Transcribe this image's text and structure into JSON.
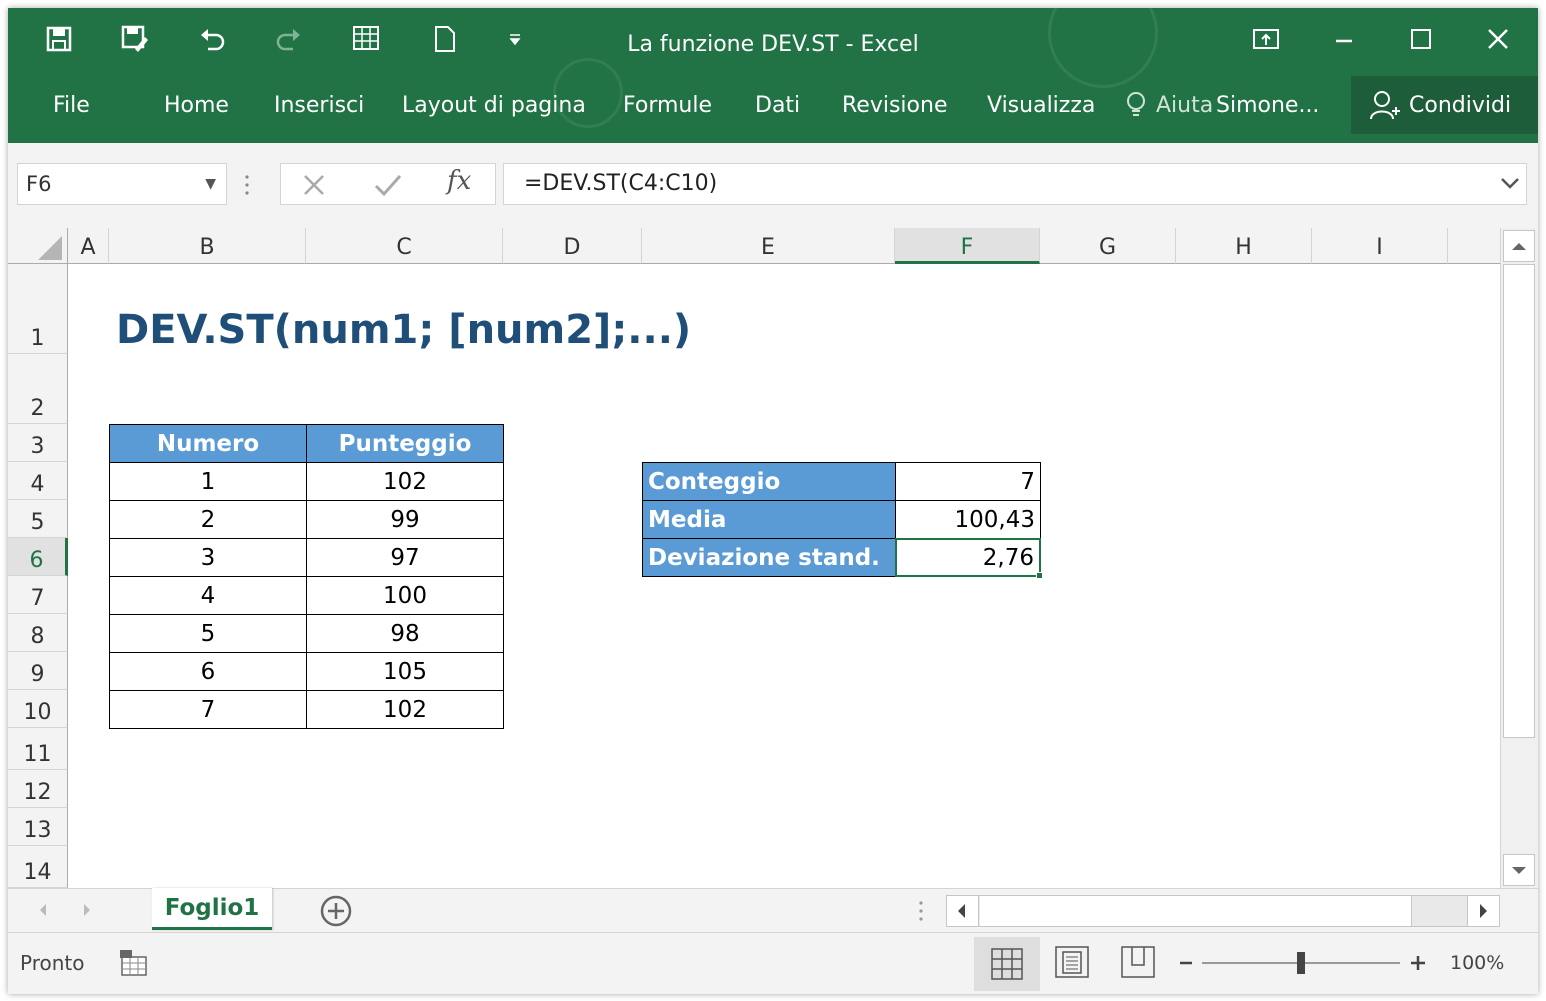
{
  "window": {
    "title": "La funzione DEV.ST  -  Excel"
  },
  "ribbon": {
    "tabs": [
      "File",
      "Home",
      "Inserisci",
      "Layout di pagina",
      "Formule",
      "Dati",
      "Revisione",
      "Visualizza"
    ],
    "tell_me": "Aiuta",
    "user": "Simone...",
    "share_label": "Condividi"
  },
  "formula_bar": {
    "name_box": "F6",
    "fx_label": "fx",
    "formula": "=DEV.ST(C4:C10)"
  },
  "grid": {
    "columns": [
      "A",
      "B",
      "C",
      "D",
      "E",
      "F",
      "G",
      "H",
      "I"
    ],
    "selected_column": "F",
    "rows": [
      "1",
      "2",
      "3",
      "4",
      "5",
      "6",
      "7",
      "8",
      "9",
      "10",
      "11",
      "12",
      "13",
      "14"
    ],
    "selected_row": "6",
    "heading": "DEV.ST(num1; [num2];...)"
  },
  "data_table": {
    "headers": [
      "Numero",
      "Punteggio"
    ],
    "rows": [
      [
        "1",
        "102"
      ],
      [
        "2",
        "99"
      ],
      [
        "3",
        "97"
      ],
      [
        "4",
        "100"
      ],
      [
        "5",
        "98"
      ],
      [
        "6",
        "105"
      ],
      [
        "7",
        "102"
      ]
    ]
  },
  "stats_table": {
    "rows": [
      {
        "label": "Conteggio",
        "value": "7"
      },
      {
        "label": "Media",
        "value": "100,43"
      },
      {
        "label": "Deviazione stand.",
        "value": "2,76"
      }
    ]
  },
  "sheets": {
    "active": "Foglio1"
  },
  "status": {
    "text": "Pronto",
    "zoom": "100%",
    "zoom_level_percent": 100
  },
  "colors": {
    "brand": "#217346",
    "header_fill": "#5b9bd5",
    "heading_text": "#1f4e79"
  }
}
